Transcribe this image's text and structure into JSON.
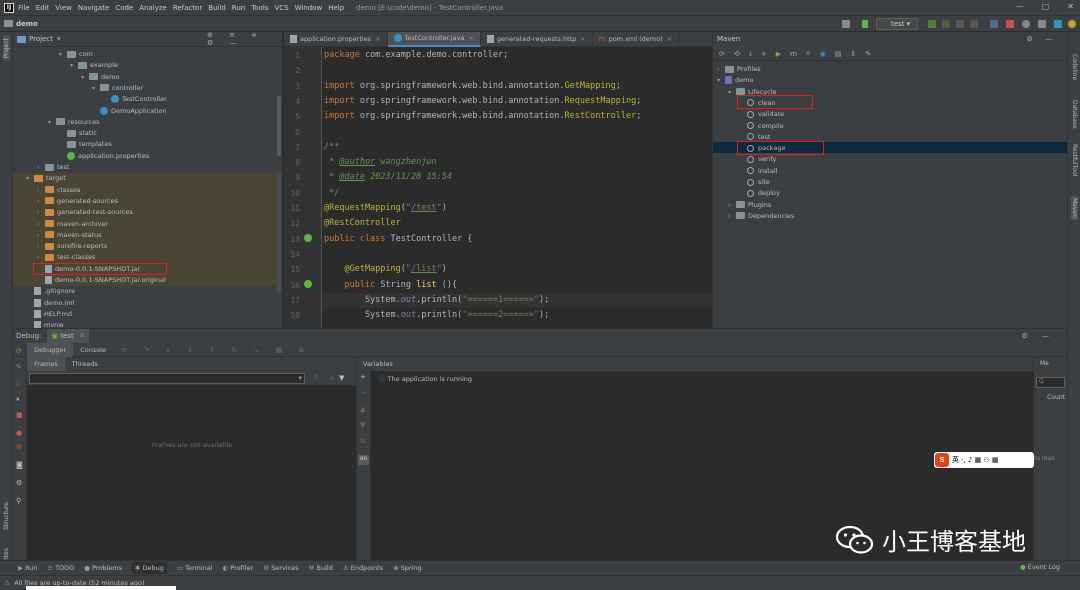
{
  "menubar": {
    "items": [
      "File",
      "Edit",
      "View",
      "Navigate",
      "Code",
      "Analyze",
      "Refactor",
      "Build",
      "Run",
      "Tools",
      "VCS",
      "Window",
      "Help"
    ],
    "title": "demo [E:\\code\\demo] - TestController.java"
  },
  "navbar": {
    "project": "demo",
    "run_config": "test"
  },
  "project": {
    "header": "Project",
    "nodes": [
      {
        "label": "com",
        "indent": 4,
        "icon": "folder",
        "arrow": "v"
      },
      {
        "label": "example",
        "indent": 5,
        "icon": "folder",
        "arrow": "v"
      },
      {
        "label": "demo",
        "indent": 6,
        "icon": "folder",
        "arrow": "v"
      },
      {
        "label": "controller",
        "indent": 7,
        "icon": "folder",
        "arrow": "v"
      },
      {
        "label": "TestController",
        "indent": 8,
        "icon": "class",
        "arrow": ""
      },
      {
        "label": "DemoApplication",
        "indent": 7,
        "icon": "class",
        "arrow": ""
      },
      {
        "label": "resources",
        "indent": 3,
        "icon": "folder",
        "arrow": "v"
      },
      {
        "label": "static",
        "indent": 4,
        "icon": "folder",
        "arrow": ""
      },
      {
        "label": "templates",
        "indent": 4,
        "icon": "folder",
        "arrow": ""
      },
      {
        "label": "application.properties",
        "indent": 4,
        "icon": "spring",
        "arrow": ""
      },
      {
        "label": "test",
        "indent": 2,
        "icon": "folder",
        "arrow": ">"
      },
      {
        "label": "target",
        "indent": 1,
        "icon": "folder-orange",
        "arrow": "v"
      },
      {
        "label": "classes",
        "indent": 2,
        "icon": "folder-orange",
        "arrow": ">"
      },
      {
        "label": "generated-sources",
        "indent": 2,
        "icon": "folder-orange",
        "arrow": ">"
      },
      {
        "label": "generated-test-sources",
        "indent": 2,
        "icon": "folder-orange",
        "arrow": ">"
      },
      {
        "label": "maven-archiver",
        "indent": 2,
        "icon": "folder-orange",
        "arrow": ">"
      },
      {
        "label": "maven-status",
        "indent": 2,
        "icon": "folder-orange",
        "arrow": ">"
      },
      {
        "label": "surefire-reports",
        "indent": 2,
        "icon": "folder-orange",
        "arrow": ">"
      },
      {
        "label": "test-classes",
        "indent": 2,
        "icon": "folder-orange",
        "arrow": ">"
      },
      {
        "label": "demo-0.0.1-SNAPSHOT.jar",
        "indent": 2,
        "icon": "file",
        "arrow": ""
      },
      {
        "label": "demo-0.0.1-SNAPSHOT.jar.original",
        "indent": 2,
        "icon": "file",
        "arrow": ""
      },
      {
        "label": ".gitignore",
        "indent": 1,
        "icon": "file",
        "arrow": ""
      },
      {
        "label": "demo.iml",
        "indent": 1,
        "icon": "file",
        "arrow": ""
      },
      {
        "label": "HELP.md",
        "indent": 1,
        "icon": "file",
        "arrow": ""
      },
      {
        "label": "mvnw",
        "indent": 1,
        "icon": "file",
        "arrow": ""
      }
    ]
  },
  "editor": {
    "tabs": [
      {
        "label": "application.properties",
        "active": false
      },
      {
        "label": "TestController.java",
        "active": true
      },
      {
        "label": "generated-requests.http",
        "active": false
      },
      {
        "label": "pom.xml (demo)",
        "active": false
      }
    ],
    "lines": [
      {
        "n": "1",
        "html": "<span class='kw'>package</span> com.example.demo.controller;"
      },
      {
        "n": "2",
        "html": ""
      },
      {
        "n": "3",
        "html": "<span class='kw'>import</span> org.springframework.web.bind.annotation.<span class='ann'>GetMapping</span>;"
      },
      {
        "n": "4",
        "html": "<span class='kw'>import</span> org.springframework.web.bind.annotation.<span class='ann'>RequestMapping</span>;"
      },
      {
        "n": "5",
        "html": "<span class='kw'>import</span> org.springframework.web.bind.annotation.<span class='ann'>RestController</span>;"
      },
      {
        "n": "6",
        "html": ""
      },
      {
        "n": "7",
        "html": "<span class='cm'>/**</span>"
      },
      {
        "n": "8",
        "html": "<span class='cm'> * <u>@author</u> wangzhenjun</span>"
      },
      {
        "n": "9",
        "html": "<span class='cm'> * <u>@date</u> 2023/11/28 15:54</span>"
      },
      {
        "n": "10",
        "html": "<span class='cm'> */</span>"
      },
      {
        "n": "11",
        "html": "<span class='ann'>@RequestMapping</span>(<span class='str'>\"<span class='url'>/test</span>\"</span>)"
      },
      {
        "n": "12",
        "html": "<span class='ann'>@RestController</span>"
      },
      {
        "n": "13",
        "html": "<span class='kw'>public class</span> TestController {"
      },
      {
        "n": "14",
        "html": ""
      },
      {
        "n": "15",
        "html": "    <span class='ann'>@GetMapping</span>(<span class='str'>\"<span class='url'>/list</span>\"</span>)"
      },
      {
        "n": "16",
        "html": "    <span class='kw'>public</span> String <span style='color:#ffc66d'>list</span> (){"
      },
      {
        "n": "17",
        "html": "        System.<span class='fld'>out</span>.println(<span class='str'>\"======1======\"</span>);"
      },
      {
        "n": "18",
        "html": "        System.<span class='fld'>out</span>.println(<span class='str'>\"======2======\"</span>);"
      }
    ]
  },
  "maven": {
    "title": "Maven",
    "nodes": [
      {
        "label": "Profiles",
        "indent": 0,
        "arrow": ">",
        "icon": "folder"
      },
      {
        "label": "demo",
        "indent": 0,
        "arrow": "v",
        "icon": "maven"
      },
      {
        "label": "Lifecycle",
        "indent": 1,
        "arrow": "v",
        "icon": "folder"
      },
      {
        "label": "clean",
        "indent": 2,
        "arrow": "",
        "icon": "gear"
      },
      {
        "label": "validate",
        "indent": 2,
        "arrow": "",
        "icon": "gear"
      },
      {
        "label": "compile",
        "indent": 2,
        "arrow": "",
        "icon": "gear"
      },
      {
        "label": "test",
        "indent": 2,
        "arrow": "",
        "icon": "gear"
      },
      {
        "label": "package",
        "indent": 2,
        "arrow": "",
        "icon": "gear"
      },
      {
        "label": "verify",
        "indent": 2,
        "arrow": "",
        "icon": "gear"
      },
      {
        "label": "install",
        "indent": 2,
        "arrow": "",
        "icon": "gear"
      },
      {
        "label": "site",
        "indent": 2,
        "arrow": "",
        "icon": "gear"
      },
      {
        "label": "deploy",
        "indent": 2,
        "arrow": "",
        "icon": "gear"
      },
      {
        "label": "Plugins",
        "indent": 1,
        "arrow": ">",
        "icon": "folder"
      },
      {
        "label": "Dependencies",
        "indent": 1,
        "arrow": ">",
        "icon": "folder"
      }
    ]
  },
  "debug": {
    "label": "Debug:",
    "session": "test",
    "tabs": [
      "Debugger",
      "Console"
    ],
    "subtabs": [
      "Frames",
      "Threads"
    ],
    "frames_empty": "Frames are not available",
    "variables_title": "Variables",
    "status": "The application is running",
    "watch_tab": "Me",
    "count": "Count",
    "hint": "nt to load"
  },
  "bottombar": [
    "Run",
    "TODO",
    "Problems",
    "Debug",
    "Terminal",
    "Profiler",
    "Services",
    "Build",
    "Endpoints",
    "Spring"
  ],
  "event_log": "Event Log",
  "status_text": "All files are up-to-date (52 minutes ago)",
  "left_strip": [
    "Project",
    "Structure",
    "Favorites"
  ],
  "right_strip": [
    "Codeline",
    "Database",
    "RestfulTool",
    "Maven"
  ],
  "ime": {
    "logo": "S",
    "text": "英 ·, ♪ ▦ ⚇ ▦"
  },
  "watermark": "小王博客基地",
  "colors": {
    "highlight_box": "#e02020",
    "selection": "#0d293e",
    "accent": "#4a88c7"
  }
}
